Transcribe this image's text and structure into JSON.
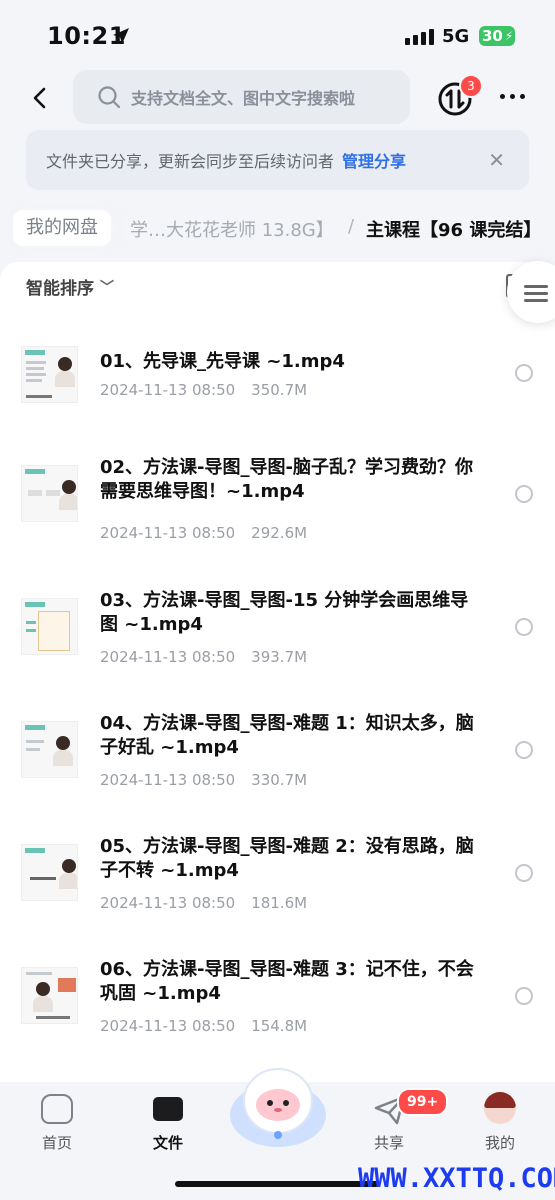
{
  "status": {
    "time": "10:21",
    "network": "5G",
    "battery": "30"
  },
  "search": {
    "placeholder": "支持文档全文、图中文字搜索啦"
  },
  "transfer_badge": "3",
  "notice": {
    "text": "文件夹已分享，更新会同步至后续访问者",
    "link": "管理分享"
  },
  "breadcrumb": {
    "root": "我的网盘",
    "middle": "学…大花花老师 13.8G】",
    "separator": "/",
    "current": "主课程【96 课完结】"
  },
  "sort_label": "智能排序",
  "files": [
    {
      "name": "01、先导课_先导课 ~1.mp4",
      "date": "2024-11-13 08:50",
      "size": "350.7M"
    },
    {
      "name": "02、方法课-导图_导图-脑子乱？学习费劲？你需要思维导图！~1.mp4",
      "date": "2024-11-13 08:50",
      "size": "292.6M"
    },
    {
      "name": "03、方法课-导图_导图-15 分钟学会画思维导图 ~1.mp4",
      "date": "2024-11-13 08:50",
      "size": "393.7M"
    },
    {
      "name": "04、方法课-导图_导图-难题 1：知识太多，脑子好乱 ~1.mp4",
      "date": "2024-11-13 08:50",
      "size": "330.7M"
    },
    {
      "name": "05、方法课-导图_导图-难题 2：没有思路，脑子不转 ~1.mp4",
      "date": "2024-11-13 08:50",
      "size": "181.6M"
    },
    {
      "name": "06、方法课-导图_导图-难题 3：记不住，不会巩固 ~1.mp4",
      "date": "2024-11-13 08:50",
      "size": "154.8M"
    }
  ],
  "tabs": [
    {
      "label": "首页",
      "icon": "home-icon"
    },
    {
      "label": "文件",
      "icon": "folder-icon"
    },
    {
      "label": "共享",
      "icon": "share-icon",
      "badge": "99+"
    },
    {
      "label": "我的",
      "icon": "avatar-icon"
    }
  ],
  "watermark": "WWW.XXTTQ.COM",
  "colors": {
    "accent": "#2f6fe8",
    "badge": "#ff4a4a",
    "battery": "#3cc466"
  }
}
